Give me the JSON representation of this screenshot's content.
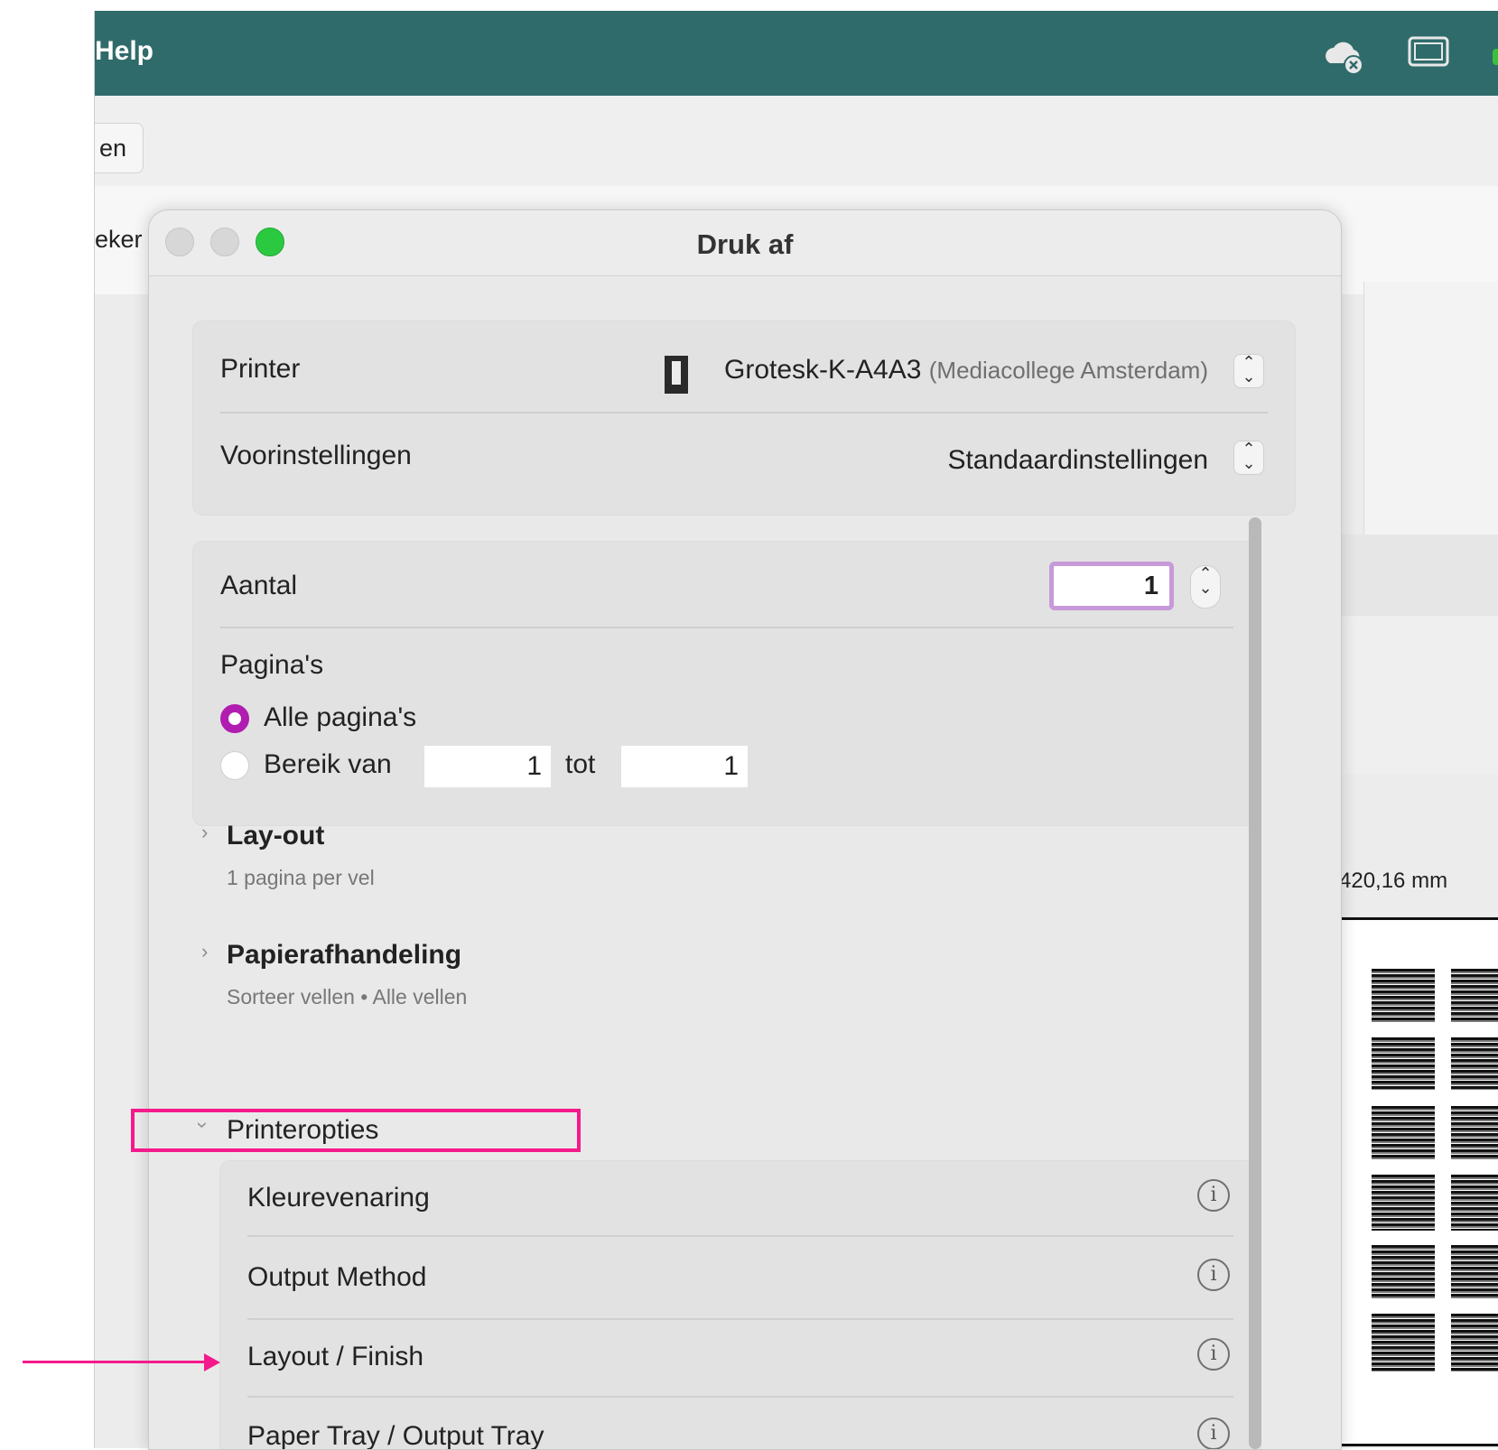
{
  "app": {
    "menu_help": "Help",
    "toolbar_button": "en",
    "subbar_partial": "eker",
    "preview_dimension": "420,16 mm",
    "icons": [
      "cloud-error-icon",
      "window-icon"
    ]
  },
  "dialog": {
    "title": "Druk af",
    "printer_label": "Printer",
    "printer_name": "Grotesk-K-A4A3",
    "printer_location": "(Mediacollege Amsterdam)",
    "presets_label": "Voorinstellingen",
    "presets_value": "Standaardinstellingen",
    "copies_label": "Aantal",
    "copies_value": "1",
    "pages_heading": "Pagina's",
    "all_pages_label": "Alle pagina's",
    "range_label": "Bereik van",
    "range_from": "1",
    "range_to_label": "tot",
    "range_to": "1",
    "layout": {
      "title": "Lay-out",
      "subtitle": "1 pagina per vel"
    },
    "paper_handling": {
      "title": "Papierafhandeling",
      "subtitle": "Sorteer vellen • Alle vellen"
    },
    "printer_options": {
      "title": "Printeropties",
      "items": [
        {
          "label": "Kleurevenaring"
        },
        {
          "label": "Output Method"
        },
        {
          "label": "Layout / Finish"
        },
        {
          "label": "Paper Tray / Output Tray"
        }
      ]
    }
  },
  "colors": {
    "titlebar": "#306b6b",
    "accent": "#b01db0",
    "annotation": "#f41a8c",
    "close_button": "#2bc940"
  }
}
